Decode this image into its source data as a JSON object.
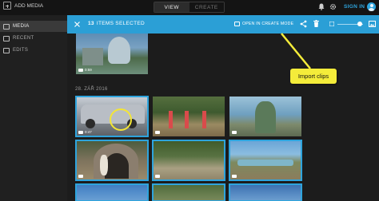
{
  "topbar": {
    "add_media_label": "ADD MEDIA",
    "tabs": [
      {
        "label": "VIEW",
        "active": true
      },
      {
        "label": "CREATE",
        "active": false
      }
    ],
    "sign_in_label": "SIGN IN",
    "icons": [
      "plus-icon",
      "bell-icon",
      "gear-icon",
      "user-icon"
    ]
  },
  "sidebar": {
    "items": [
      {
        "label": "MEDIA",
        "icon": "media-icon",
        "active": true
      },
      {
        "label": "RECENT",
        "icon": "recent-icon",
        "active": false
      },
      {
        "label": "EDITS",
        "icon": "edits-icon",
        "active": false
      }
    ]
  },
  "selection_bar": {
    "count": "13",
    "label": "ITEMS SELECTED",
    "open_create_label": "OPEN IN CREATE MODE",
    "accent": "#2b9fd6"
  },
  "content": {
    "date_header": "28. ZÁŘ 2016",
    "top_thumb_duration": "0:59",
    "thumb_duration_a": "0:47"
  },
  "callout": {
    "text": "Import clips",
    "color": "#f4ec3a"
  }
}
